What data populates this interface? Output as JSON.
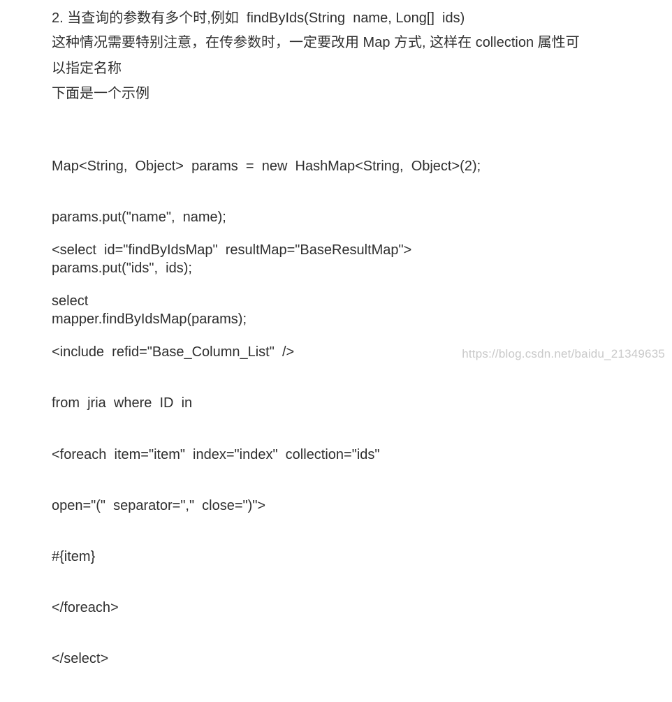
{
  "content": {
    "intro_line": "2. 当查询的参数有多个时,例如  findByIds(String  name, Long[]  ids)",
    "note_line_1": "这种情况需要特别注意，在传参数时，一定要改用 Map 方式, 这样在 collection 属性可",
    "note_line_2": "以指定名称",
    "example_label": "下面是一个示例",
    "java_code": [
      "Map<String,  Object>  params  =  new  HashMap<String,  Object>(2);",
      "params.put(\"name\",  name);",
      "params.put(\"ids\",  ids);",
      "mapper.findByIdsMap(params);"
    ],
    "xml_code": [
      "<select  id=\"findByIdsMap\"  resultMap=\"BaseResultMap\">",
      "select",
      "<include  refid=\"Base_Column_List\"  />",
      "from  jria  where  ID  in",
      "<foreach  item=\"item\"  index=\"index\"  collection=\"ids\"",
      "open=\"(\"  separator=\",\"  close=\")\">",
      "#{item}",
      "</foreach>",
      "</select>"
    ]
  },
  "watermark": "https://blog.csdn.net/baidu_21349635"
}
